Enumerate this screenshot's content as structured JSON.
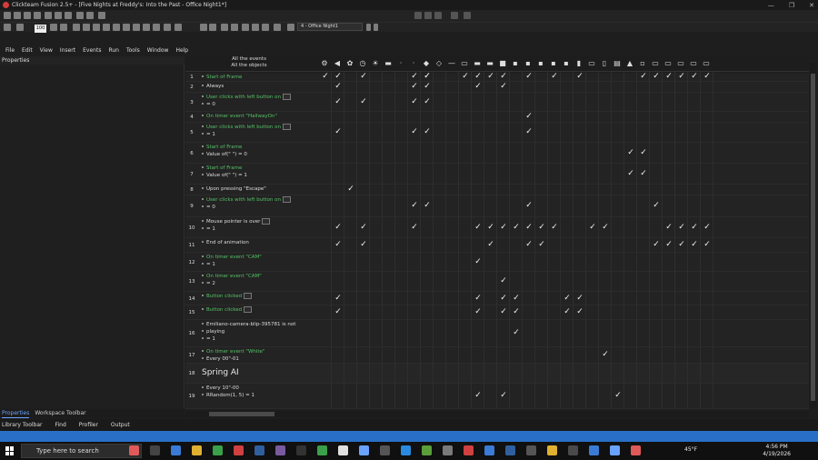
{
  "window": {
    "app_name": "Clickteam Fusion 2.5+",
    "document": "[Five Nights at Freddy's: Into the Past - Office Night1*]",
    "minimize": "—",
    "restore": "❐",
    "close": "✕"
  },
  "toolbar": {
    "zoom": "100",
    "frame": "4 - Office Night1"
  },
  "menu": [
    "File",
    "Edit",
    "View",
    "Insert",
    "Events",
    "Run",
    "Tools",
    "Window",
    "Help"
  ],
  "properties_panel": {
    "title": "Properties"
  },
  "event_editor": {
    "header_line1": "All the events",
    "header_line2": "All the objects",
    "group_title": "Spring AI",
    "rows": [
      {
        "num": "1",
        "lines": [
          "Start of Frame"
        ]
      },
      {
        "num": "2",
        "lines": [
          "Always"
        ]
      },
      {
        "num": "3",
        "lines": [
          "User clicks with left button on",
          "= 0"
        ]
      },
      {
        "num": "4",
        "lines": [
          "On timer event \"HallwayOn\""
        ]
      },
      {
        "num": "5",
        "lines": [
          "User clicks with left button on",
          "= 1"
        ]
      },
      {
        "num": "6",
        "lines": [
          "Start of Frame",
          "Value of(\" \") = 0"
        ]
      },
      {
        "num": "7",
        "lines": [
          "Start of Frame",
          "Value of(\" \") = 1"
        ]
      },
      {
        "num": "8",
        "lines": [
          "Upon pressing \"Escape\""
        ]
      },
      {
        "num": "9",
        "lines": [
          "User clicks with left button on",
          "= 0"
        ]
      },
      {
        "num": "10",
        "lines": [
          "Mouse pointer is over",
          "= 1"
        ]
      },
      {
        "num": "11",
        "lines": [
          "End of animation"
        ]
      },
      {
        "num": "12",
        "lines": [
          "On timer event \"CAM\"",
          "= 1"
        ]
      },
      {
        "num": "13",
        "lines": [
          "On timer event \"CAM\"",
          "= 2"
        ]
      },
      {
        "num": "14",
        "lines": [
          "Button clicked"
        ]
      },
      {
        "num": "15",
        "lines": [
          "Button clicked"
        ]
      },
      {
        "num": "16",
        "lines": [
          "Emiliano-camera-blip-395781 is not",
          "playing",
          "= 1"
        ]
      },
      {
        "num": "17",
        "lines": [
          "On timer event \"White\"",
          "Every 00\"-01"
        ]
      },
      {
        "num": "18",
        "lines": [
          "Spring AI"
        ]
      },
      {
        "num": "19",
        "lines": [
          "Every 10\"-00",
          "RRandom(1, 5) = 1"
        ]
      }
    ]
  },
  "bottom_tabs": [
    "Properties",
    "Workspace Toolbar"
  ],
  "bottom_bar": [
    "Library Toolbar",
    "Find",
    "Profiler",
    "Output"
  ],
  "taskbar": {
    "search_placeholder": "Type here to search",
    "weather": "45°F",
    "time": "4:56 PM",
    "date": "4/19/2026"
  },
  "check_mark": "✓"
}
